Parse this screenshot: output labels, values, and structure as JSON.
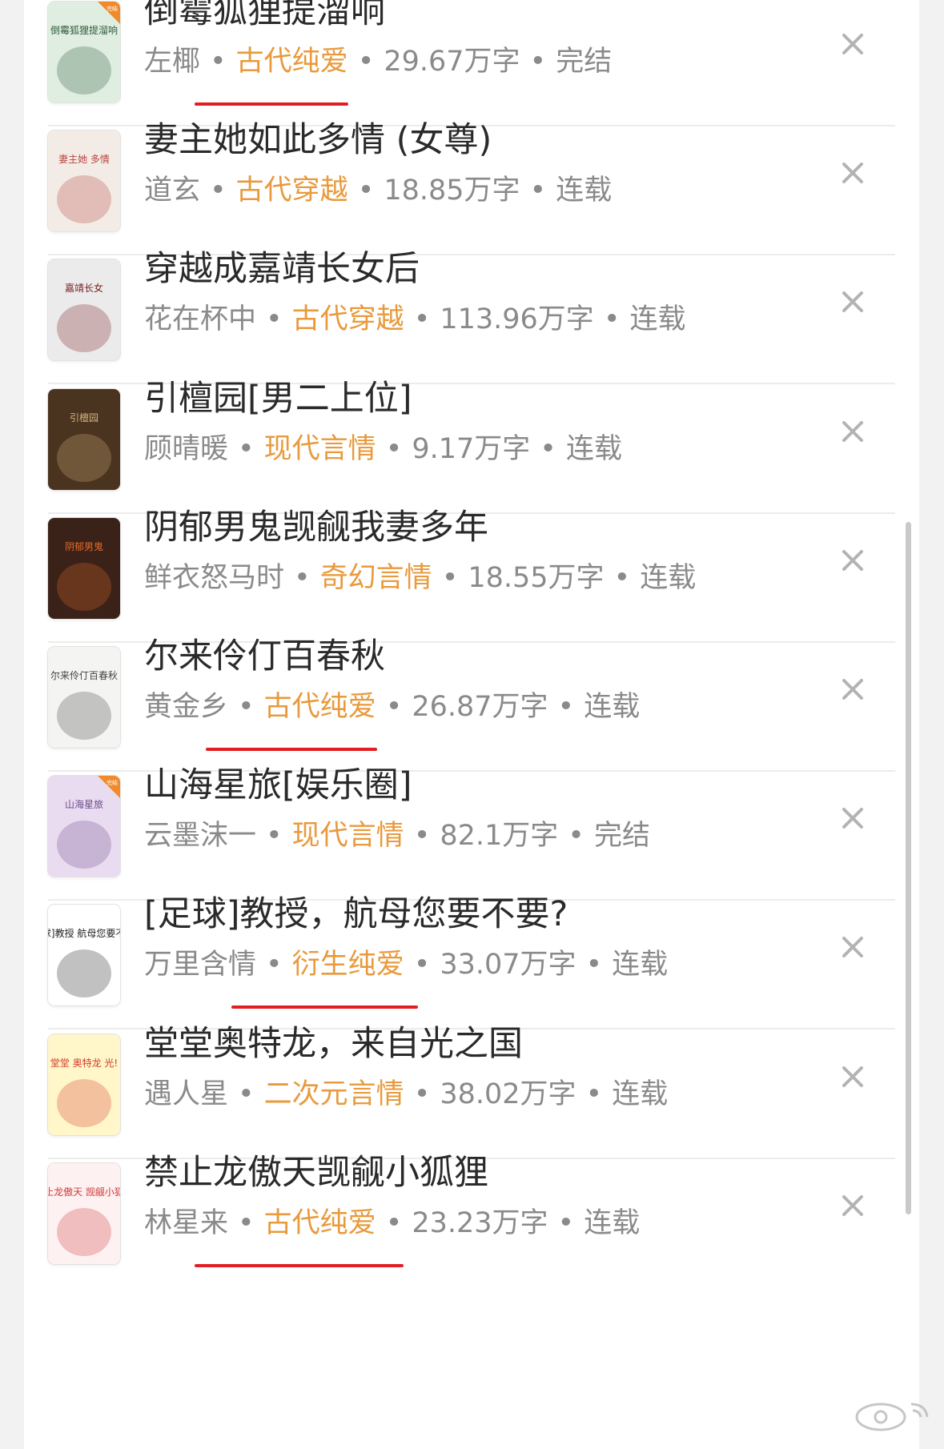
{
  "books": [
    {
      "title": "倒霉狐狸提溜响",
      "author": "左椰",
      "genre": "古代纯爱",
      "words": "29.67万字",
      "status": "完结",
      "cover_badge": "完结",
      "cover_text": "倒霉狐狸提溜响",
      "cover_colors": [
        "#dfeee0",
        "#2f5b3c"
      ]
    },
    {
      "title": "妻主她如此多情 (女尊)",
      "author": "道玄",
      "genre": "古代穿越",
      "words": "18.85万字",
      "status": "连载",
      "cover_badge": "",
      "cover_text": "妻主她 多情",
      "cover_colors": [
        "#f3ece6",
        "#b7463d"
      ]
    },
    {
      "title": "穿越成嘉靖长女后",
      "author": "花在杯中",
      "genre": "古代穿越",
      "words": "113.96万字",
      "status": "连载",
      "cover_badge": "",
      "cover_text": "嘉靖长女",
      "cover_colors": [
        "#ecebeb",
        "#7a1d22"
      ]
    },
    {
      "title": "引檀园[男二上位]",
      "author": "顾晴暖",
      "genre": "现代言情",
      "words": "9.17万字",
      "status": "连载",
      "cover_badge": "",
      "cover_text": "引檀园",
      "cover_colors": [
        "#4a3420",
        "#d6b27a"
      ]
    },
    {
      "title": "阴郁男鬼觊觎我妻多年",
      "author": "鲜衣怒马时",
      "genre": "奇幻言情",
      "words": "18.55万字",
      "status": "连载",
      "cover_badge": "",
      "cover_text": "阴郁男鬼",
      "cover_colors": [
        "#3b2218",
        "#e06a2c"
      ]
    },
    {
      "title": "尔来伶仃百春秋",
      "author": "黄金乡",
      "genre": "古代纯爱",
      "words": "26.87万字",
      "status": "连载",
      "cover_badge": "",
      "cover_text": "尔来伶仃百春秋",
      "cover_colors": [
        "#f4f4f2",
        "#444444"
      ]
    },
    {
      "title": "山海星旅[娱乐圈]",
      "author": "云墨沫一",
      "genre": "现代言情",
      "words": "82.1万字",
      "status": "完结",
      "cover_badge": "完结",
      "cover_text": "山海星旅",
      "cover_colors": [
        "#eadcf0",
        "#6a4a8a"
      ]
    },
    {
      "title": "[足球]教授，航母您要不要?",
      "author": "万里含情",
      "genre": "衍生纯爱",
      "words": "33.07万字",
      "status": "连载",
      "cover_badge": "",
      "cover_text": "[足球]教授 航母您要不要?",
      "cover_colors": [
        "#ffffff",
        "#222222"
      ]
    },
    {
      "title": "堂堂奥特龙，来自光之国",
      "author": "遇人星",
      "genre": "二次元言情",
      "words": "38.02万字",
      "status": "连载",
      "cover_badge": "",
      "cover_text": "堂堂 奥特龙 光!",
      "cover_colors": [
        "#fff6c9",
        "#d43a2a"
      ]
    },
    {
      "title": "禁止龙傲天觊觎小狐狸",
      "author": "林星来",
      "genre": "古代纯爱",
      "words": "23.23万字",
      "status": "连载",
      "cover_badge": "",
      "cover_text": "禁止龙傲天 觊觎小狐狸",
      "cover_colors": [
        "#fdf1f1",
        "#d23a3a"
      ]
    }
  ],
  "colors": {
    "genre": "#e89a3c",
    "underline": "#e11f22",
    "title": "#2a2a2a",
    "meta": "#8a8a8a",
    "close": "#b3b3b3"
  },
  "underlined_genres": [
    0,
    5,
    7,
    9
  ],
  "dismiss_icon": "close-icon",
  "watermark_icon": "weibo-logo-icon"
}
